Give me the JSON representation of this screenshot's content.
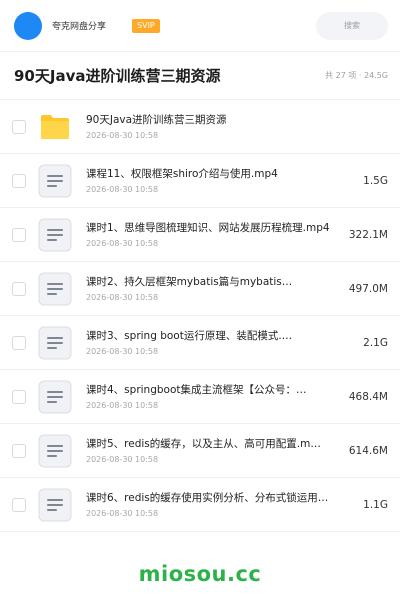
{
  "header": {
    "account_name": "夸克网盘分享",
    "vip_label": "SVIP",
    "search_placeholder": "搜索"
  },
  "folder": {
    "title": "90天Java进阶训练营三期资源",
    "summary": "共 27 项 · 24.5G"
  },
  "files": [
    {
      "name": "90天Java进阶训练营三期资源",
      "date": "2026-08-30 10:58",
      "size": "",
      "type": "folder",
      "icon": "folder-icon"
    },
    {
      "name": "课程11、权限框架shiro介绍与使用.mp4",
      "date": "2026-08-30 10:58",
      "size": "1.5G",
      "type": "file",
      "icon": "document-icon"
    },
    {
      "name": "课时1、思维导图梳理知识、网站发展历程梳理.mp4",
      "date": "2026-08-30 10:58",
      "size": "322.1M",
      "type": "file",
      "icon": "document-icon"
    },
    {
      "name": "课时2、持久层框架mybatis篇与mybatis…",
      "date": "2026-08-30 10:58",
      "size": "497.0M",
      "type": "file",
      "icon": "document-icon"
    },
    {
      "name": "课时3、spring boot运行原理、装配模式.…",
      "date": "2026-08-30 10:58",
      "size": "2.1G",
      "type": "file",
      "icon": "document-icon"
    },
    {
      "name": "课时4、springboot集成主流框架【公众号：…",
      "date": "2026-08-30 10:58",
      "size": "468.4M",
      "type": "file",
      "icon": "document-icon"
    },
    {
      "name": "课时5、redis的缓存，以及主从、高可用配置.m…",
      "date": "2026-08-30 10:58",
      "size": "614.6M",
      "type": "file",
      "icon": "document-icon"
    },
    {
      "name": "课时6、redis的缓存使用实例分析、分布式锁运用…",
      "date": "2026-08-30 10:58",
      "size": "1.1G",
      "type": "file",
      "icon": "document-icon"
    }
  ],
  "colors": {
    "avatar": "#1e88f5",
    "vip_badge": "#ffa928",
    "folder": "#ffc62b",
    "watermark": "#2db24a"
  },
  "watermark": "miosou.cc"
}
